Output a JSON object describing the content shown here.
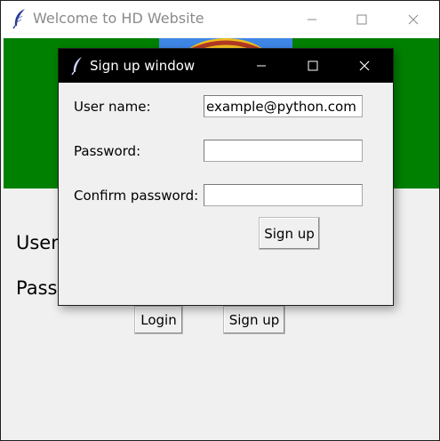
{
  "main_window": {
    "title": "Welcome to HD Website",
    "banner_color": "#008000",
    "labels": {
      "user": "User",
      "pass": "Pass"
    },
    "buttons": {
      "login": "Login",
      "signup": "Sign up"
    }
  },
  "dialog": {
    "title": "Sign up window",
    "fields": {
      "user_label": "User name:",
      "user_value": "example@python.com",
      "password_label": "Password:",
      "password_value": "",
      "confirm_label": "Confirm password:",
      "confirm_value": ""
    },
    "signup_label": "Sign up"
  },
  "icons": {
    "app": "feather-icon",
    "minimize": "minimize-icon",
    "maximize": "maximize-icon",
    "close": "close-icon"
  }
}
